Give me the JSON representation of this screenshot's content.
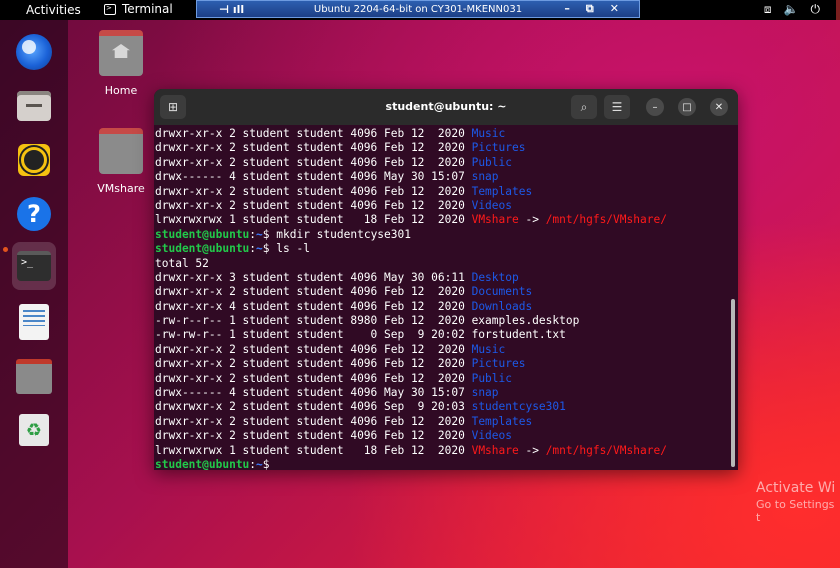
{
  "topbar": {
    "activities": "Activities",
    "terminal_label": "Terminal"
  },
  "vm": {
    "title": "Ubuntu 2204-64-bit on CY301-MKENN031",
    "minimize": "–",
    "restore": "⧉",
    "close": "✕"
  },
  "desktop": {
    "home_label": "Home",
    "vmshare_label": "VMshare"
  },
  "terminal": {
    "title": "student@ubuntu: ~",
    "lines": [
      [
        {
          "t": "drwxr-xr-x 2 student student 4096 Feb 12  2020 "
        },
        {
          "t": "Music",
          "c": "dir"
        }
      ],
      [
        {
          "t": "drwxr-xr-x 2 student student 4096 Feb 12  2020 "
        },
        {
          "t": "Pictures",
          "c": "dir"
        }
      ],
      [
        {
          "t": "drwxr-xr-x 2 student student 4096 Feb 12  2020 "
        },
        {
          "t": "Public",
          "c": "dir"
        }
      ],
      [
        {
          "t": "drwx------ 4 student student 4096 May 30 15:07 "
        },
        {
          "t": "snap",
          "c": "dir"
        }
      ],
      [
        {
          "t": "drwxr-xr-x 2 student student 4096 Feb 12  2020 "
        },
        {
          "t": "Templates",
          "c": "dir"
        }
      ],
      [
        {
          "t": "drwxr-xr-x 2 student student 4096 Feb 12  2020 "
        },
        {
          "t": "Videos",
          "c": "dir"
        }
      ],
      [
        {
          "t": "lrwxrwxrwx 1 student student   18 Feb 12  2020 "
        },
        {
          "t": "VMshare",
          "c": "lnk"
        },
        {
          "t": " -> "
        },
        {
          "t": "/mnt/hgfs/VMshare/",
          "c": "lnk"
        }
      ],
      [
        {
          "t": "student@ubuntu",
          "c": "pu"
        },
        {
          "t": ":"
        },
        {
          "t": "~",
          "c": "pp"
        },
        {
          "t": "$ mkdir studentcyse301"
        }
      ],
      [
        {
          "t": "student@ubuntu",
          "c": "pu"
        },
        {
          "t": ":"
        },
        {
          "t": "~",
          "c": "pp"
        },
        {
          "t": "$ ls -l"
        }
      ],
      [
        {
          "t": "total 52"
        }
      ],
      [
        {
          "t": "drwxr-xr-x 3 student student 4096 May 30 06:11 "
        },
        {
          "t": "Desktop",
          "c": "dir"
        }
      ],
      [
        {
          "t": "drwxr-xr-x 2 student student 4096 Feb 12  2020 "
        },
        {
          "t": "Documents",
          "c": "dir"
        }
      ],
      [
        {
          "t": "drwxr-xr-x 4 student student 4096 Feb 12  2020 "
        },
        {
          "t": "Downloads",
          "c": "dir"
        }
      ],
      [
        {
          "t": "-rw-r--r-- 1 student student 8980 Feb 12  2020 examples.desktop"
        }
      ],
      [
        {
          "t": "-rw-rw-r-- 1 student student    0 Sep  9 20:02 forstudent.txt"
        }
      ],
      [
        {
          "t": "drwxr-xr-x 2 student student 4096 Feb 12  2020 "
        },
        {
          "t": "Music",
          "c": "dir"
        }
      ],
      [
        {
          "t": "drwxr-xr-x 2 student student 4096 Feb 12  2020 "
        },
        {
          "t": "Pictures",
          "c": "dir"
        }
      ],
      [
        {
          "t": "drwxr-xr-x 2 student student 4096 Feb 12  2020 "
        },
        {
          "t": "Public",
          "c": "dir"
        }
      ],
      [
        {
          "t": "drwx------ 4 student student 4096 May 30 15:07 "
        },
        {
          "t": "snap",
          "c": "dir"
        }
      ],
      [
        {
          "t": "drwxrwxr-x 2 student student 4096 Sep  9 20:03 "
        },
        {
          "t": "studentcyse301",
          "c": "dir"
        }
      ],
      [
        {
          "t": "drwxr-xr-x 2 student student 4096 Feb 12  2020 "
        },
        {
          "t": "Templates",
          "c": "dir"
        }
      ],
      [
        {
          "t": "drwxr-xr-x 2 student student 4096 Feb 12  2020 "
        },
        {
          "t": "Videos",
          "c": "dir"
        }
      ],
      [
        {
          "t": "lrwxrwxrwx 1 student student   18 Feb 12  2020 "
        },
        {
          "t": "VMshare",
          "c": "lnk"
        },
        {
          "t": " -> "
        },
        {
          "t": "/mnt/hgfs/VMshare/",
          "c": "lnk"
        }
      ],
      [
        {
          "t": "student@ubuntu",
          "c": "pu"
        },
        {
          "t": ":"
        },
        {
          "t": "~",
          "c": "pp"
        },
        {
          "t": "$ "
        }
      ]
    ]
  },
  "watermark": {
    "line1": "Activate Wi",
    "line2": "Go to Settings t"
  },
  "icons": {
    "dock": [
      "firefox-icon",
      "files-icon",
      "rhythmbox-icon",
      "help-icon",
      "terminal-icon",
      "writer-icon",
      "folder-icon",
      "trash-icon"
    ]
  },
  "colors": {
    "terminal_bg": "#300a24",
    "directory": "#1d59e8",
    "symlink": "#ff1a1a",
    "prompt_user": "#22c94a",
    "prompt_path": "#3a7bff"
  }
}
